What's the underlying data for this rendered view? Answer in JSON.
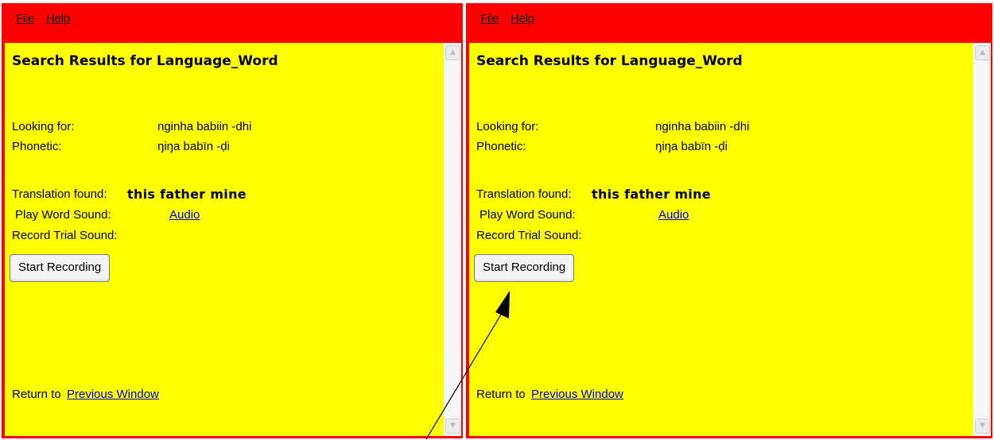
{
  "menu": {
    "file_label": "File",
    "help_label": "Help"
  },
  "page": {
    "title": "Search Results for Language_Word",
    "looking_for_label": "Looking for:",
    "looking_for_value": "nginha  babiin -dhi",
    "phonetic_label": "Phonetic:",
    "phonetic_value": "ŋiŋa  babïn -ḍi",
    "translation_label": "Translation found:",
    "translation_value": "this  father  mine",
    "play_label": "Play Word Sound:",
    "audio_link": "Audio",
    "record_label": "Record Trial Sound:",
    "record_button": "Start Recording",
    "return_text": "Return to",
    "previous_window_link": "Previous Window"
  },
  "colors": {
    "menubar": "#ff0000",
    "content_bg": "#ffff00",
    "link": "#0000cc"
  }
}
